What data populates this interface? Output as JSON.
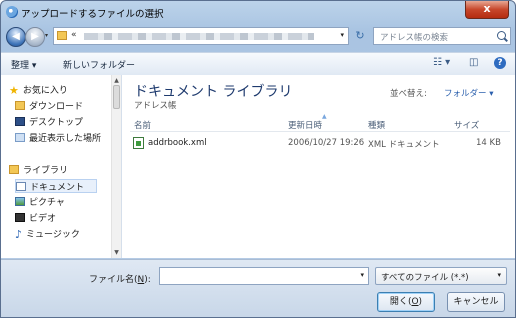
{
  "window": {
    "title": "アップロードするファイルの選択",
    "close_glyph": "x"
  },
  "nav": {
    "back_glyph": "◀",
    "forward_glyph": "▶",
    "history_glyph": "▾",
    "path_sep": "«",
    "path_drop": "▾",
    "refresh_glyph": "↻"
  },
  "search": {
    "placeholder": "アドレス帳の検索"
  },
  "toolbar": {
    "organize": "整理 ▾",
    "new_folder": "新しいフォルダー",
    "view_glyph": "☷ ▾",
    "pane_glyph": "◫",
    "help": "?"
  },
  "sidebar": {
    "items": [
      {
        "label": "お気に入り"
      },
      {
        "label": "ダウンロード"
      },
      {
        "label": "デスクトップ"
      },
      {
        "label": "最近表示した場所"
      },
      {
        "label": "ライブラリ"
      },
      {
        "label": "ドキュメント"
      },
      {
        "label": "ピクチャ"
      },
      {
        "label": "ビデオ"
      },
      {
        "label": "ミュージック"
      }
    ],
    "up": "▲",
    "down": "▼"
  },
  "main": {
    "title": "ドキュメント ライブラリ",
    "subtitle": "アドレス帳",
    "arrange_label": "並べ替え:",
    "arrange_value": "フォルダー ▾",
    "columns": {
      "name": "名前",
      "date": "更新日時",
      "type": "種類",
      "size": "サイズ"
    },
    "sort_glyph": "▲",
    "files": [
      {
        "name": "addrbook.xml",
        "date": "2006/10/27 19:26",
        "type": "XML ドキュメント",
        "size": "14 KB"
      }
    ]
  },
  "bottom": {
    "filename_label": "ファイル名",
    "filename_key": "N",
    "filename_value": "",
    "drop_glyph": "▾",
    "type_value": "すべてのファイル (*.*)",
    "open_label": "開く",
    "open_key": "O",
    "cancel_label": "キャンセル"
  }
}
